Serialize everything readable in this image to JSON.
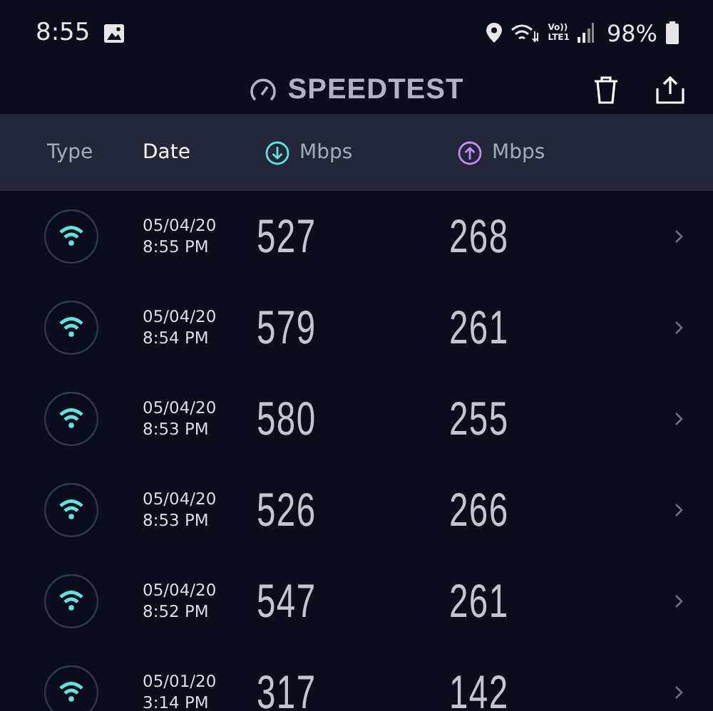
{
  "status_bar": {
    "time": "8:55",
    "network_top": "Vo))",
    "network_bottom": "LTE1",
    "battery": "98%"
  },
  "app_bar": {
    "title": "SPEEDTEST"
  },
  "table": {
    "columns": [
      {
        "label": "Type",
        "kind": "text"
      },
      {
        "label": "Date",
        "kind": "text"
      },
      {
        "label": "Mbps",
        "kind": "download"
      },
      {
        "label": "Mbps",
        "kind": "upload"
      }
    ],
    "rows": [
      {
        "kind": "wifi",
        "date": "05/04/20",
        "time": "8:55 PM",
        "download": "527",
        "upload": "268"
      },
      {
        "kind": "wifi",
        "date": "05/04/20",
        "time": "8:54 PM",
        "download": "579",
        "upload": "261"
      },
      {
        "kind": "wifi",
        "date": "05/04/20",
        "time": "8:53 PM",
        "download": "580",
        "upload": "255"
      },
      {
        "kind": "wifi",
        "date": "05/04/20",
        "time": "8:53 PM",
        "download": "526",
        "upload": "266"
      },
      {
        "kind": "wifi",
        "date": "05/04/20",
        "time": "8:52 PM",
        "download": "547",
        "upload": "261"
      },
      {
        "kind": "wifi",
        "date": "05/01/20",
        "time": "3:14 PM",
        "download": "317",
        "upload": "142"
      }
    ]
  }
}
